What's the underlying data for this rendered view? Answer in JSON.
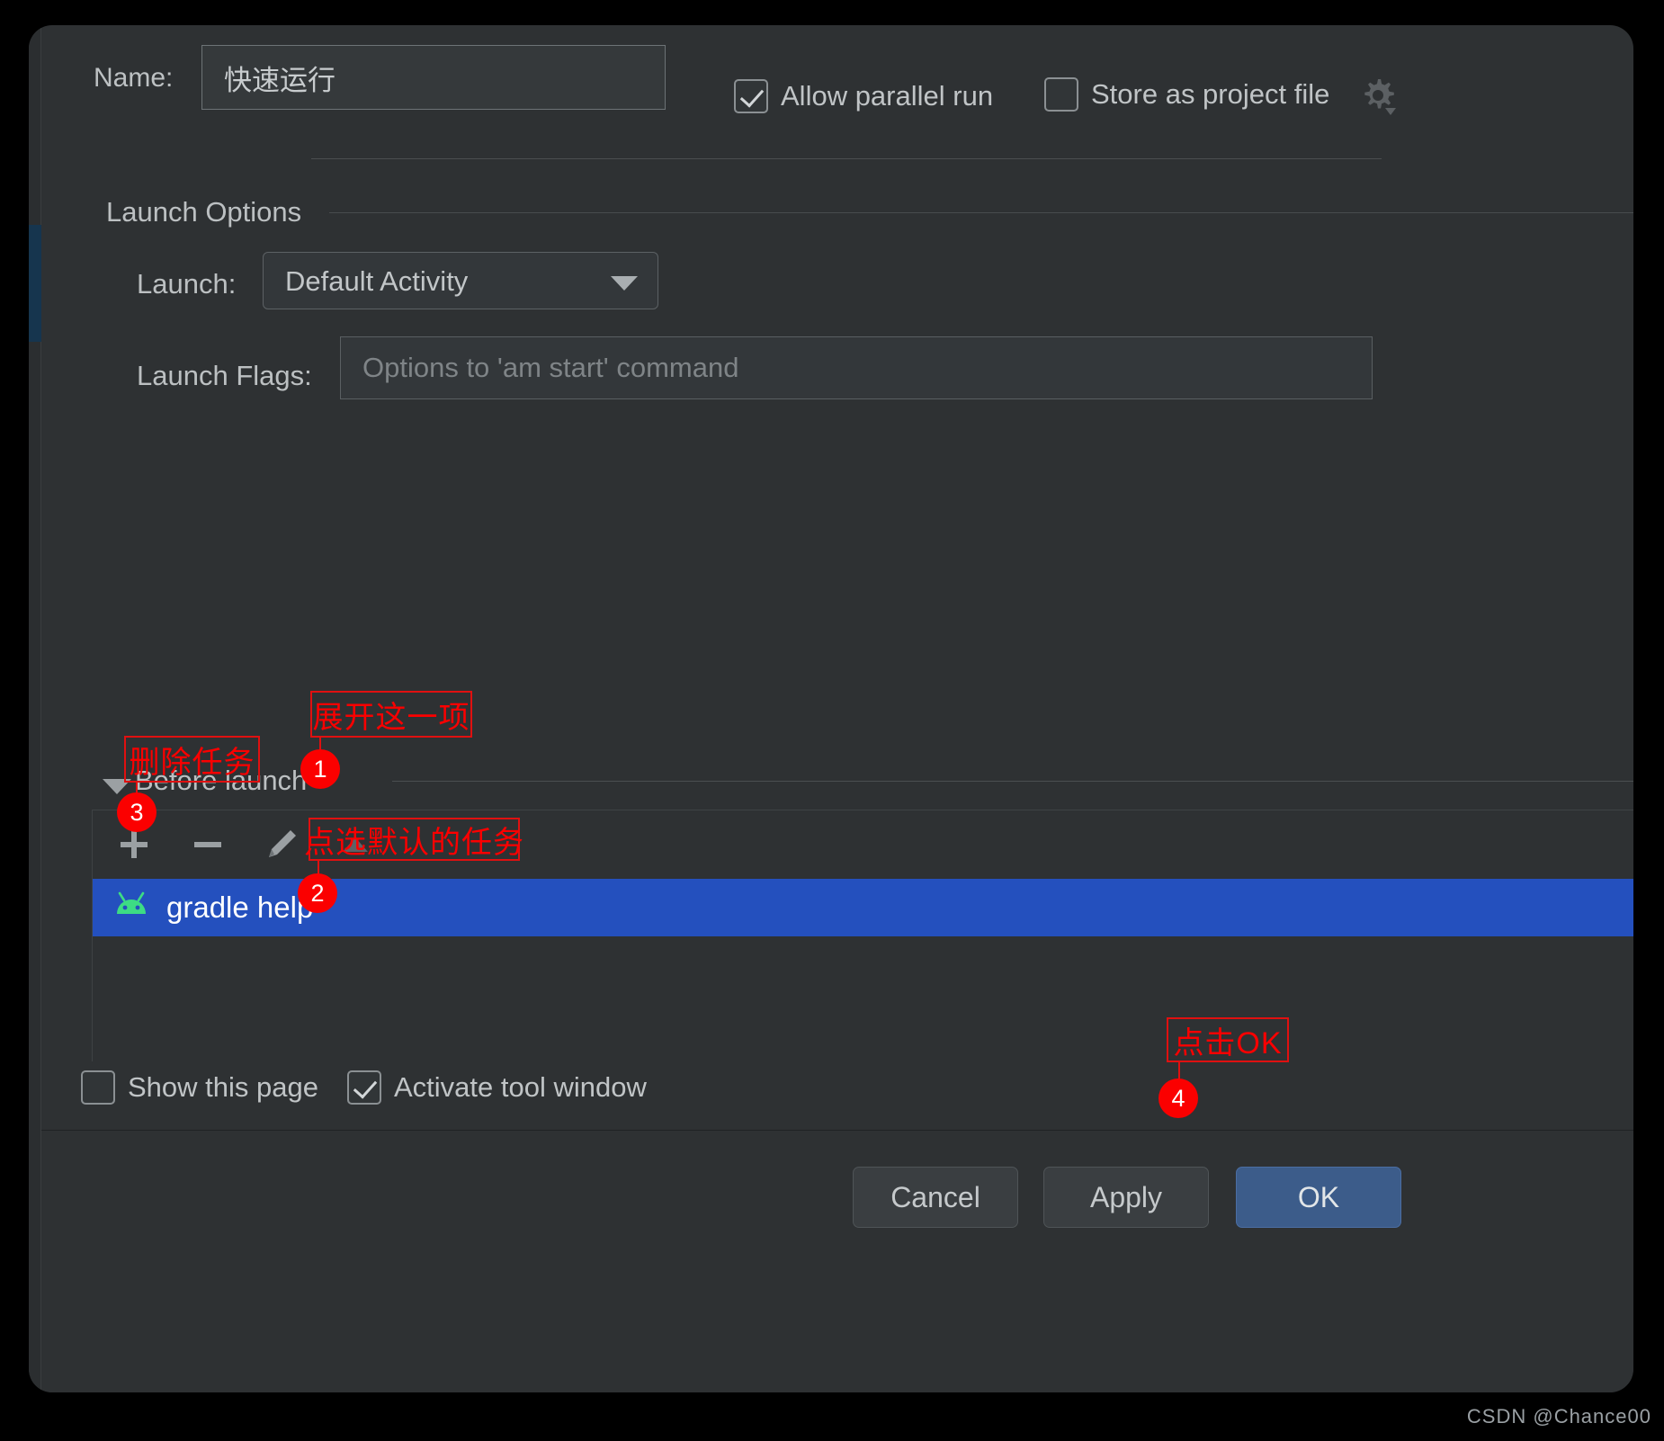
{
  "dialog": {
    "name_label": "Name:",
    "name_value": "快速运行",
    "allow_parallel_run": "Allow parallel run",
    "store_as_project_file": "Store as project file",
    "gear_icon": "gear-icon"
  },
  "launch_options": {
    "group_title": "Launch Options",
    "launch_label": "Launch:",
    "launch_selected": "Default Activity",
    "flags_label": "Launch Flags:",
    "flags_placeholder": "Options to 'am start' command",
    "flags_value": ""
  },
  "before_launch": {
    "title": "Before launch",
    "toolbar": {
      "add": "add-icon",
      "remove": "remove-icon",
      "edit": "pencil-icon",
      "move_up": "arrow-up-icon"
    },
    "tasks": [
      {
        "icon": "android-robot-icon",
        "label": "gradle help",
        "selected": true
      }
    ]
  },
  "bottom_options": {
    "show_this_page": "Show this page",
    "show_this_page_checked": false,
    "activate_tool_window": "Activate tool window",
    "activate_tool_window_checked": true
  },
  "buttons": {
    "cancel": "Cancel",
    "apply": "Apply",
    "ok": "OK"
  },
  "annotations": [
    {
      "id": 1,
      "text": "展开这一项",
      "badge": "1"
    },
    {
      "id": 2,
      "text": "点选默认的任务",
      "badge": "2"
    },
    {
      "id": 3,
      "text": "删除任务",
      "badge": "3"
    },
    {
      "id": 4,
      "text": "点击OK",
      "badge": "4"
    }
  ],
  "watermark": "CSDN @Chance00",
  "colors": {
    "dialog_bg": "#2e3133",
    "selection_blue": "#2450be",
    "annotation_red": "#fb0000",
    "android_green": "#3ddc84",
    "ok_button_blue": "#3c5c8a"
  }
}
